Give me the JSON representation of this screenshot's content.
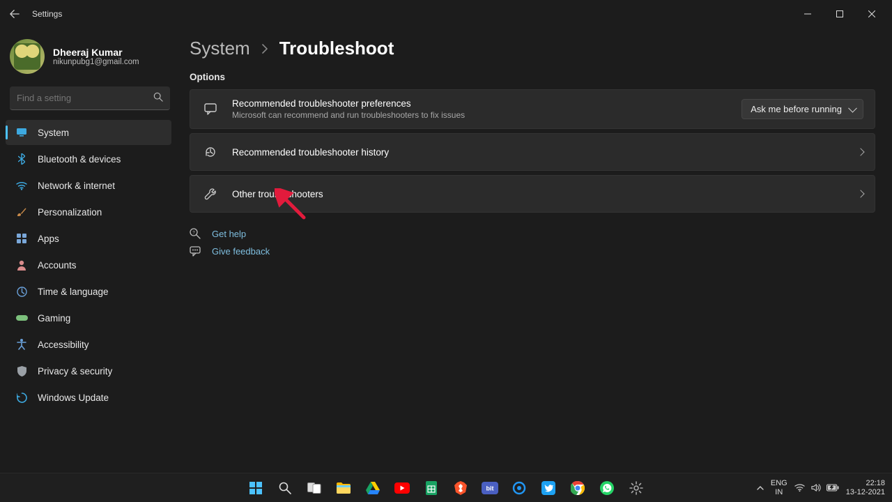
{
  "app": {
    "title": "Settings"
  },
  "window_controls": {
    "min": "–",
    "max": "▢",
    "close": "✕"
  },
  "user": {
    "name": "Dheeraj Kumar",
    "email": "nikunpubg1@gmail.com"
  },
  "search": {
    "placeholder": "Find a setting"
  },
  "sidebar": {
    "items": [
      {
        "label": "System",
        "icon": "display-icon",
        "color": "#3da9e0",
        "active": true
      },
      {
        "label": "Bluetooth & devices",
        "icon": "bluetooth-icon",
        "color": "#3da9e0"
      },
      {
        "label": "Network & internet",
        "icon": "wifi-icon",
        "color": "#3da9e0"
      },
      {
        "label": "Personalization",
        "icon": "brush-icon",
        "color": "#c98b4a"
      },
      {
        "label": "Apps",
        "icon": "apps-icon",
        "color": "#7aa7d9"
      },
      {
        "label": "Accounts",
        "icon": "person-icon",
        "color": "#d98b8b"
      },
      {
        "label": "Time & language",
        "icon": "clock-globe-icon",
        "color": "#6aa0d9"
      },
      {
        "label": "Gaming",
        "icon": "gamepad-icon",
        "color": "#7cc07c"
      },
      {
        "label": "Accessibility",
        "icon": "accessibility-icon",
        "color": "#6aa0d9"
      },
      {
        "label": "Privacy & security",
        "icon": "shield-icon",
        "color": "#9aa0a6"
      },
      {
        "label": "Windows Update",
        "icon": "update-icon",
        "color": "#3da9e0"
      }
    ]
  },
  "breadcrumb": {
    "parent": "System",
    "current": "Troubleshoot"
  },
  "main": {
    "section_label": "Options",
    "cards": [
      {
        "icon": "message-icon",
        "title": "Recommended troubleshooter preferences",
        "subtitle": "Microsoft can recommend and run troubleshooters to fix issues",
        "trailer_type": "dropdown",
        "trailer_value": "Ask me before running"
      },
      {
        "icon": "history-icon",
        "title": "Recommended troubleshooter history",
        "trailer_type": "chevron"
      },
      {
        "icon": "wrench-icon",
        "title": "Other troubleshooters",
        "trailer_type": "chevron"
      }
    ],
    "links": [
      {
        "icon": "help-icon",
        "label": "Get help"
      },
      {
        "icon": "feedback-icon",
        "label": "Give feedback"
      }
    ]
  },
  "taskbar": {
    "items": [
      {
        "name": "start-icon",
        "glyph": "",
        "color": "#4cc2ff"
      },
      {
        "name": "search-icon",
        "glyph": "",
        "color": "#ddd"
      },
      {
        "name": "task-view-icon",
        "glyph": "",
        "color": "#ddd"
      },
      {
        "name": "file-explorer-icon",
        "glyph": "📁",
        "color": ""
      },
      {
        "name": "google-drive-icon",
        "glyph": "",
        "color": "#18a363"
      },
      {
        "name": "youtube-icon",
        "glyph": "",
        "color": "#ff0000"
      },
      {
        "name": "sheets-icon",
        "glyph": "",
        "color": "#18a363"
      },
      {
        "name": "brave-icon",
        "glyph": "",
        "color": "#fb542b"
      },
      {
        "name": "bit-icon",
        "glyph": "bit",
        "color": "#3b5998"
      },
      {
        "name": "circle-icon",
        "glyph": "",
        "color": "#2196f3"
      },
      {
        "name": "twitter-icon",
        "glyph": "",
        "color": "#1da1f2"
      },
      {
        "name": "chrome-icon",
        "glyph": "",
        "color": ""
      },
      {
        "name": "whatsapp-icon",
        "glyph": "",
        "color": "#25d366"
      },
      {
        "name": "settings-icon",
        "glyph": "",
        "color": "#888"
      }
    ],
    "lang_top": "ENG",
    "lang_bottom": "IN",
    "time": "22:18",
    "date": "13-12-2021"
  }
}
